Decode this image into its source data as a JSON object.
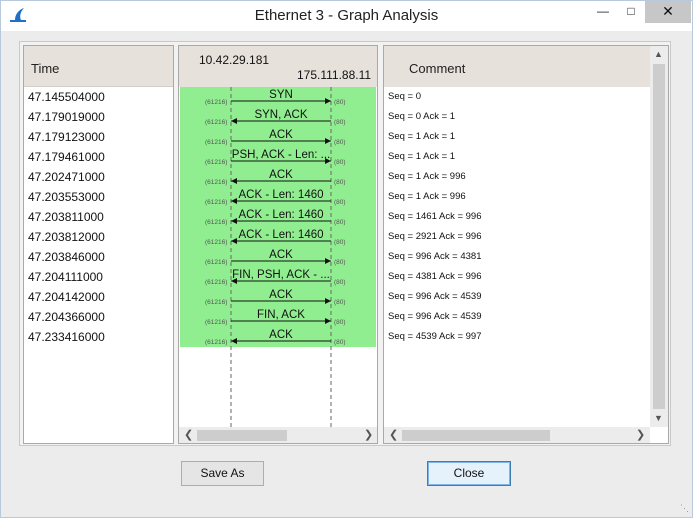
{
  "window": {
    "title": "Ethernet 3 - Graph Analysis",
    "minimize": "—",
    "maximize": "□",
    "close": "✕"
  },
  "time_panel": {
    "header": "Time",
    "rows": [
      "47.145504000",
      "47.179019000",
      "47.179123000",
      "47.179461000",
      "47.202471000",
      "47.203553000",
      "47.203811000",
      "47.203812000",
      "47.203846000",
      "47.204111000",
      "47.204142000",
      "47.204366000",
      "47.233416000"
    ]
  },
  "graph_panel": {
    "host_a": "10.42.29.181",
    "host_b": "175.111.88.11",
    "port_a": "(61216)",
    "port_b": "(80)",
    "highlight_color": "#90ee90",
    "flows": [
      {
        "label": "SYN",
        "dir": "right"
      },
      {
        "label": "SYN, ACK",
        "dir": "left"
      },
      {
        "label": "ACK",
        "dir": "right"
      },
      {
        "label": "PSH, ACK - Len: ...",
        "dir": "right"
      },
      {
        "label": "ACK",
        "dir": "left"
      },
      {
        "label": "ACK - Len: 1460",
        "dir": "left"
      },
      {
        "label": "ACK - Len: 1460",
        "dir": "left"
      },
      {
        "label": "ACK - Len: 1460",
        "dir": "left"
      },
      {
        "label": "ACK",
        "dir": "right"
      },
      {
        "label": "FIN, PSH, ACK - ...",
        "dir": "left"
      },
      {
        "label": "ACK",
        "dir": "right"
      },
      {
        "label": "FIN, ACK",
        "dir": "right"
      },
      {
        "label": "ACK",
        "dir": "left"
      }
    ]
  },
  "comment_panel": {
    "header": "Comment",
    "rows": [
      "Seq = 0",
      "Seq = 0 Ack = 1",
      "Seq = 1 Ack = 1",
      "Seq = 1 Ack = 1",
      "Seq = 1 Ack = 996",
      "Seq = 1 Ack = 996",
      "Seq = 1461 Ack = 996",
      "Seq = 2921 Ack = 996",
      "Seq = 996 Ack = 4381",
      "Seq = 4381 Ack = 996",
      "Seq = 996 Ack = 4539",
      "Seq = 996 Ack = 4539",
      "Seq = 4539 Ack = 997"
    ]
  },
  "buttons": {
    "save_as": "Save As",
    "close": "Close"
  }
}
